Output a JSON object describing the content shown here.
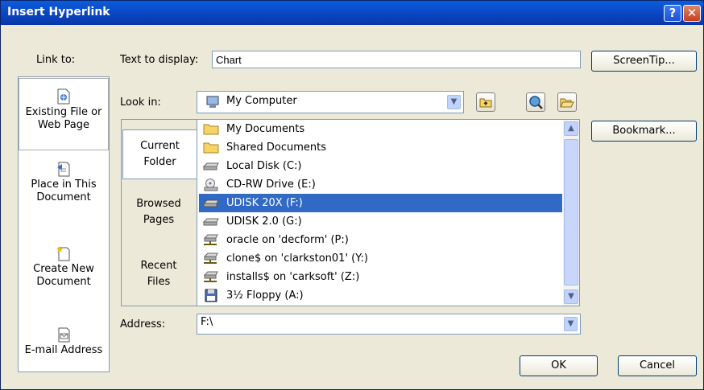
{
  "window": {
    "title": "Insert Hyperlink",
    "help_label": "?",
    "close_label": "✕"
  },
  "link_to": {
    "label": "Link to:",
    "items": [
      {
        "line1": "Existing File or",
        "line2": "Web Page",
        "icon": "existing-file-icon",
        "selected": true
      },
      {
        "line1": "Place in This",
        "line2": "Document",
        "icon": "place-in-document-icon",
        "selected": false
      },
      {
        "line1": "Create New",
        "line2": "Document",
        "icon": "create-new-document-icon",
        "selected": false
      },
      {
        "line1": "E-mail Address",
        "line2": "",
        "icon": "email-address-icon",
        "selected": false
      }
    ]
  },
  "text_to_display": {
    "label": "Text to display:",
    "value": "Chart"
  },
  "screentip_button": "ScreenTip...",
  "look_in": {
    "label": "Look in:",
    "value": "My Computer",
    "icon": "my-computer-icon"
  },
  "side_tabs": [
    {
      "line1": "Current",
      "line2": "Folder",
      "selected": true
    },
    {
      "line1": "Browsed",
      "line2": "Pages",
      "selected": false
    },
    {
      "line1": "Recent",
      "line2": "Files",
      "selected": false
    }
  ],
  "files": [
    {
      "name": "My Documents",
      "icon": "folder-icon",
      "selected": false
    },
    {
      "name": "Shared Documents",
      "icon": "folder-icon",
      "selected": false
    },
    {
      "name": "Local Disk (C:)",
      "icon": "hard-disk-icon",
      "selected": false
    },
    {
      "name": "CD-RW Drive (E:)",
      "icon": "cd-drive-icon",
      "selected": false
    },
    {
      "name": "UDISK 20X (F:)",
      "icon": "removable-disk-icon",
      "selected": true
    },
    {
      "name": "UDISK 2.0 (G:)",
      "icon": "removable-disk-icon",
      "selected": false
    },
    {
      "name": "oracle on 'decform' (P:)",
      "icon": "network-drive-icon",
      "selected": false
    },
    {
      "name": "clone$ on 'clarkston01' (Y:)",
      "icon": "network-drive-icon",
      "selected": false
    },
    {
      "name": "installs$ on 'carksoft' (Z:)",
      "icon": "network-drive-icon",
      "selected": false
    },
    {
      "name": "3½ Floppy (A:)",
      "icon": "floppy-icon",
      "selected": false
    }
  ],
  "bookmark_button": "Bookmark...",
  "address": {
    "label": "Address:",
    "value": "F:\\"
  },
  "ok_button": "OK",
  "cancel_button": "Cancel"
}
